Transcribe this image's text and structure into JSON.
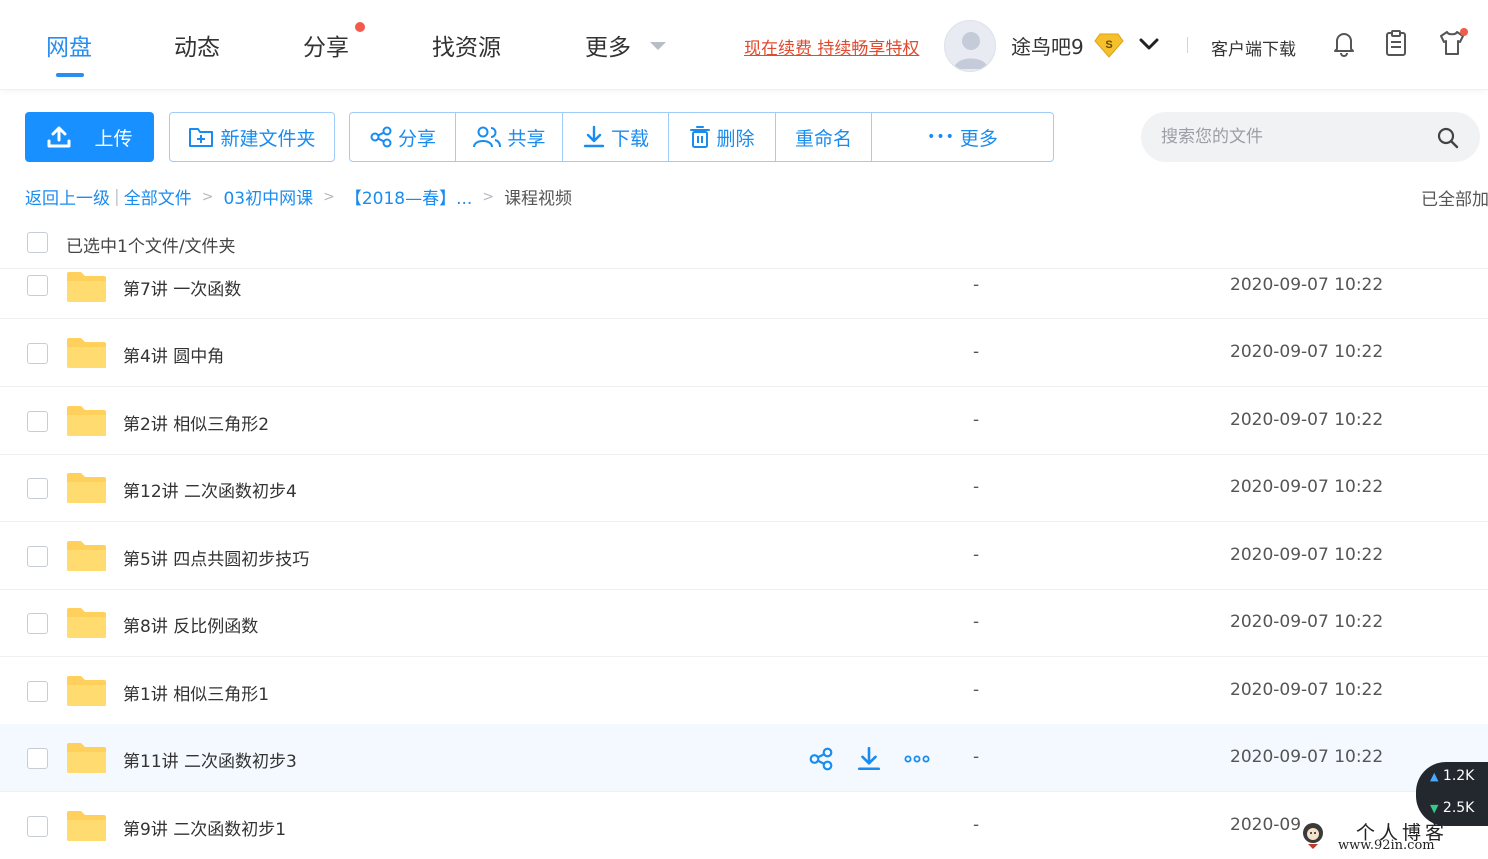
{
  "topnav": {
    "items": [
      {
        "label": "网盘",
        "active": true
      },
      {
        "label": "动态",
        "active": false
      },
      {
        "label": "分享",
        "active": false,
        "badge_dot": true
      },
      {
        "label": "找资源",
        "active": false
      },
      {
        "label": "更多",
        "active": false,
        "dropdown": true
      }
    ],
    "promo_text": "现在续费 持续畅享特权",
    "username": "途鸟吧9",
    "vip_badge": "S",
    "client_download": "客户端下载",
    "icons": [
      "bell-icon",
      "clipboard-icon",
      "shirt-icon"
    ]
  },
  "toolbar": {
    "upload": "上传",
    "new_folder": "新建文件夹",
    "group": [
      "分享",
      "共享",
      "下载",
      "删除",
      "重命名",
      "更多"
    ],
    "more_glyph": "•••"
  },
  "search": {
    "placeholder": "搜索您的文件"
  },
  "breadcrumb": {
    "back": "返回上一级",
    "bar": "|",
    "items": [
      "全部文件",
      "03初中网课",
      "【2018—春】..."
    ],
    "arrow": ">",
    "current": "课程视频"
  },
  "loaded_status": "已全部加",
  "selection": {
    "text": "已选中1个文件/文件夹"
  },
  "files": [
    {
      "name": "第7讲 一次函数",
      "size": "-",
      "date": "2020-09-07 10:22"
    },
    {
      "name": "第4讲 圆中角",
      "size": "-",
      "date": "2020-09-07 10:22"
    },
    {
      "name": "第2讲 相似三角形2",
      "size": "-",
      "date": "2020-09-07 10:22"
    },
    {
      "name": "第12讲 二次函数初步4",
      "size": "-",
      "date": "2020-09-07 10:22"
    },
    {
      "name": "第5讲 四点共圆初步技巧",
      "size": "-",
      "date": "2020-09-07 10:22"
    },
    {
      "name": "第8讲 反比例函数",
      "size": "-",
      "date": "2020-09-07 10:22"
    },
    {
      "name": "第1讲 相似三角形1",
      "size": "-",
      "date": "2020-09-07 10:22"
    },
    {
      "name": "第11讲 二次函数初步3",
      "size": "-",
      "date": "2020-09-07 10:22",
      "hovered": true
    },
    {
      "name": "第9讲 二次函数初步1",
      "size": "-",
      "date": "2020-09"
    }
  ],
  "speed_widget": {
    "up": "1.2K",
    "down": "2.5K"
  },
  "watermark": {
    "title": "个人博客",
    "url": "www.92in.com"
  },
  "colors": {
    "accent": "#1990ff",
    "link": "#1a8cf0",
    "promo": "#e04a2f",
    "badge_dot": "#f25a4a",
    "folder": "#ffd15c",
    "row_hover": "#f3f9ff"
  }
}
